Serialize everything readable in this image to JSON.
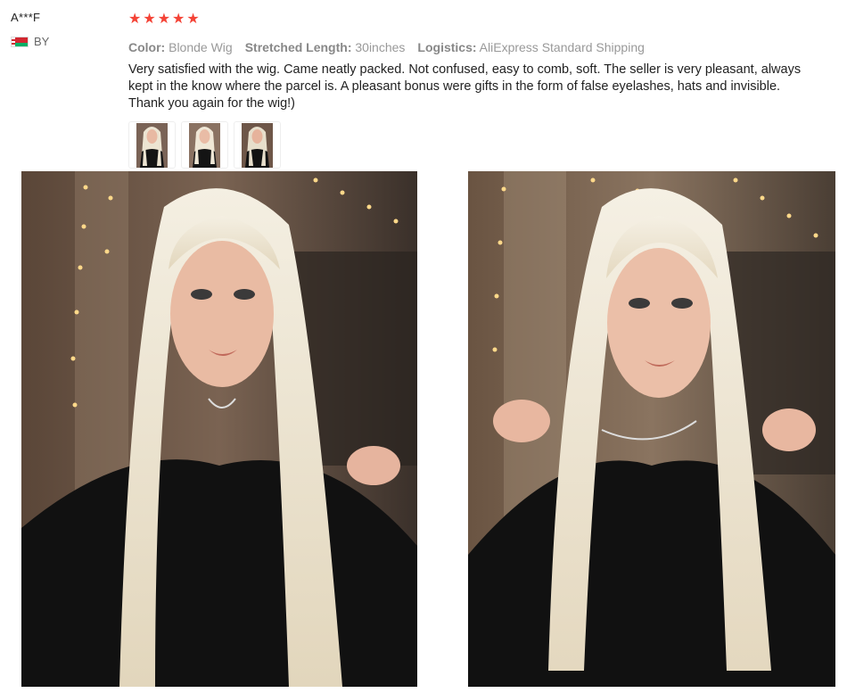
{
  "reviewer": {
    "name": "A***F",
    "country_code": "BY",
    "flag_colors": {
      "top": "#d22730",
      "bottom": "#00af66"
    }
  },
  "review": {
    "rating": 5,
    "star_color": "#f44336",
    "attributes": [
      {
        "key": "Color:",
        "value": "Blonde Wig"
      },
      {
        "key": "Stretched Length:",
        "value": "30inches"
      },
      {
        "key": "Logistics:",
        "value": "AliExpress Standard Shipping"
      }
    ],
    "text": "Very satisfied with the wig. Came neatly packed. Not confused, easy to comb, soft. The seller is very pleasant, always kept in the know where the parcel is. A pleasant bonus were gifts in the form of false eyelashes, hats and invisible. Thank you again for the wig!)",
    "thumbnails": [
      "photo-1",
      "photo-2",
      "photo-3"
    ]
  },
  "photos": [
    "woman-platinum-wig-front",
    "woman-platinum-wig-holding-hair"
  ]
}
